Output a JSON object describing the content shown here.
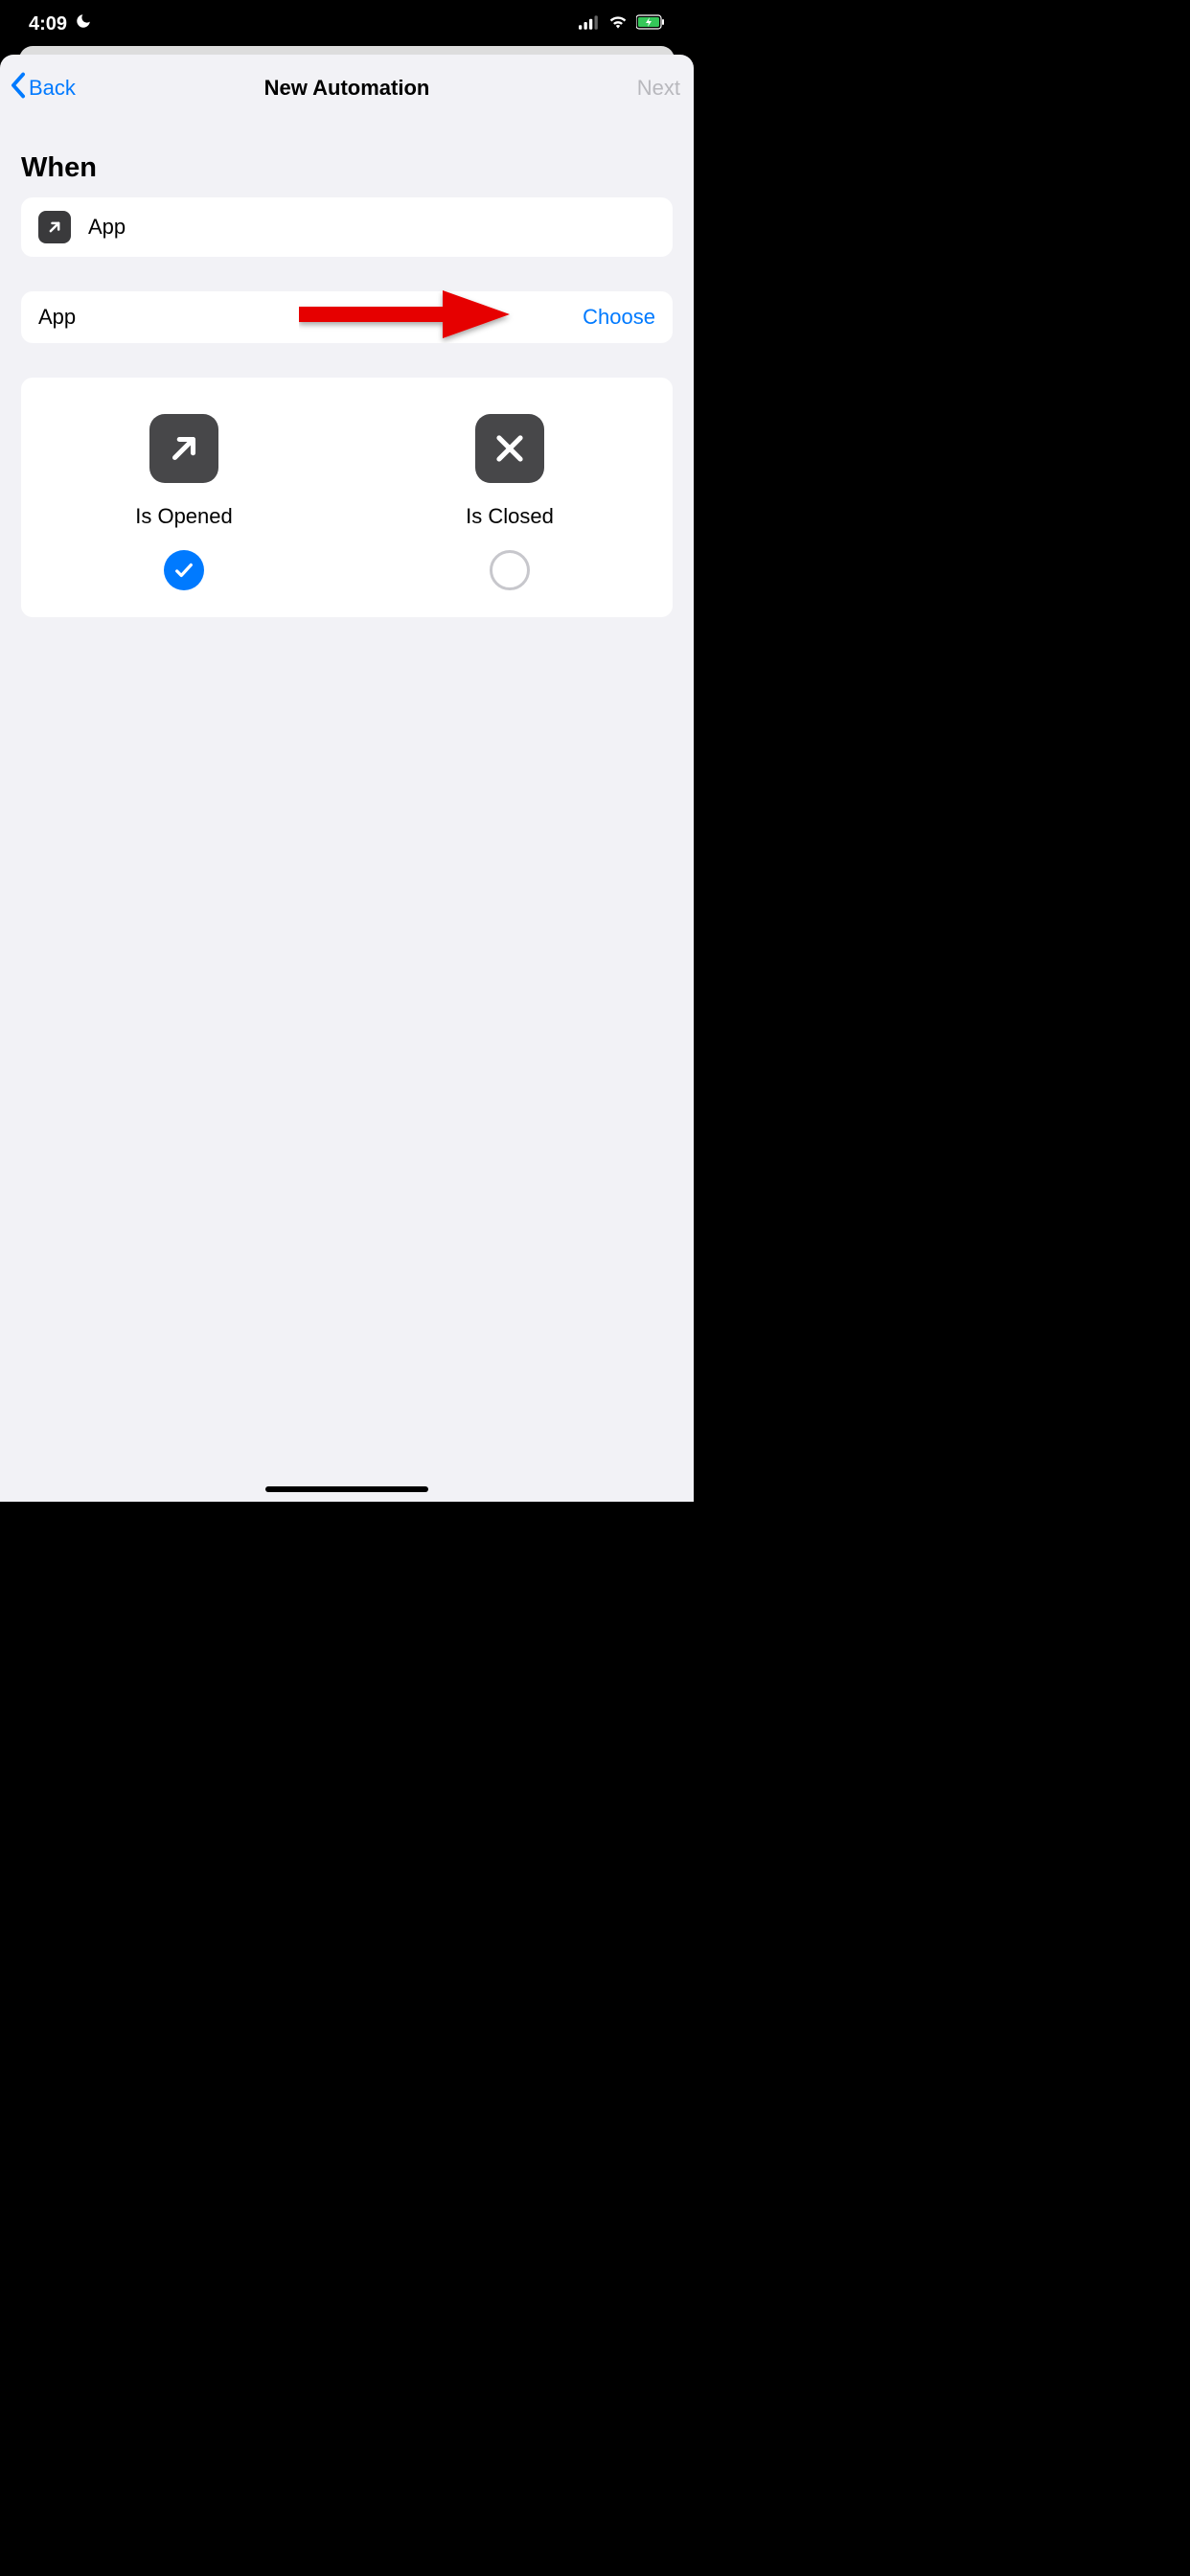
{
  "statusBar": {
    "time": "4:09"
  },
  "nav": {
    "back": "Back",
    "title": "New Automation",
    "next": "Next"
  },
  "sections": {
    "whenHeader": "When",
    "appRow": {
      "label": "App"
    },
    "chooseRow": {
      "label": "App",
      "action": "Choose"
    },
    "options": {
      "opened": {
        "label": "Is Opened",
        "selected": true
      },
      "closed": {
        "label": "Is Closed",
        "selected": false
      }
    }
  }
}
